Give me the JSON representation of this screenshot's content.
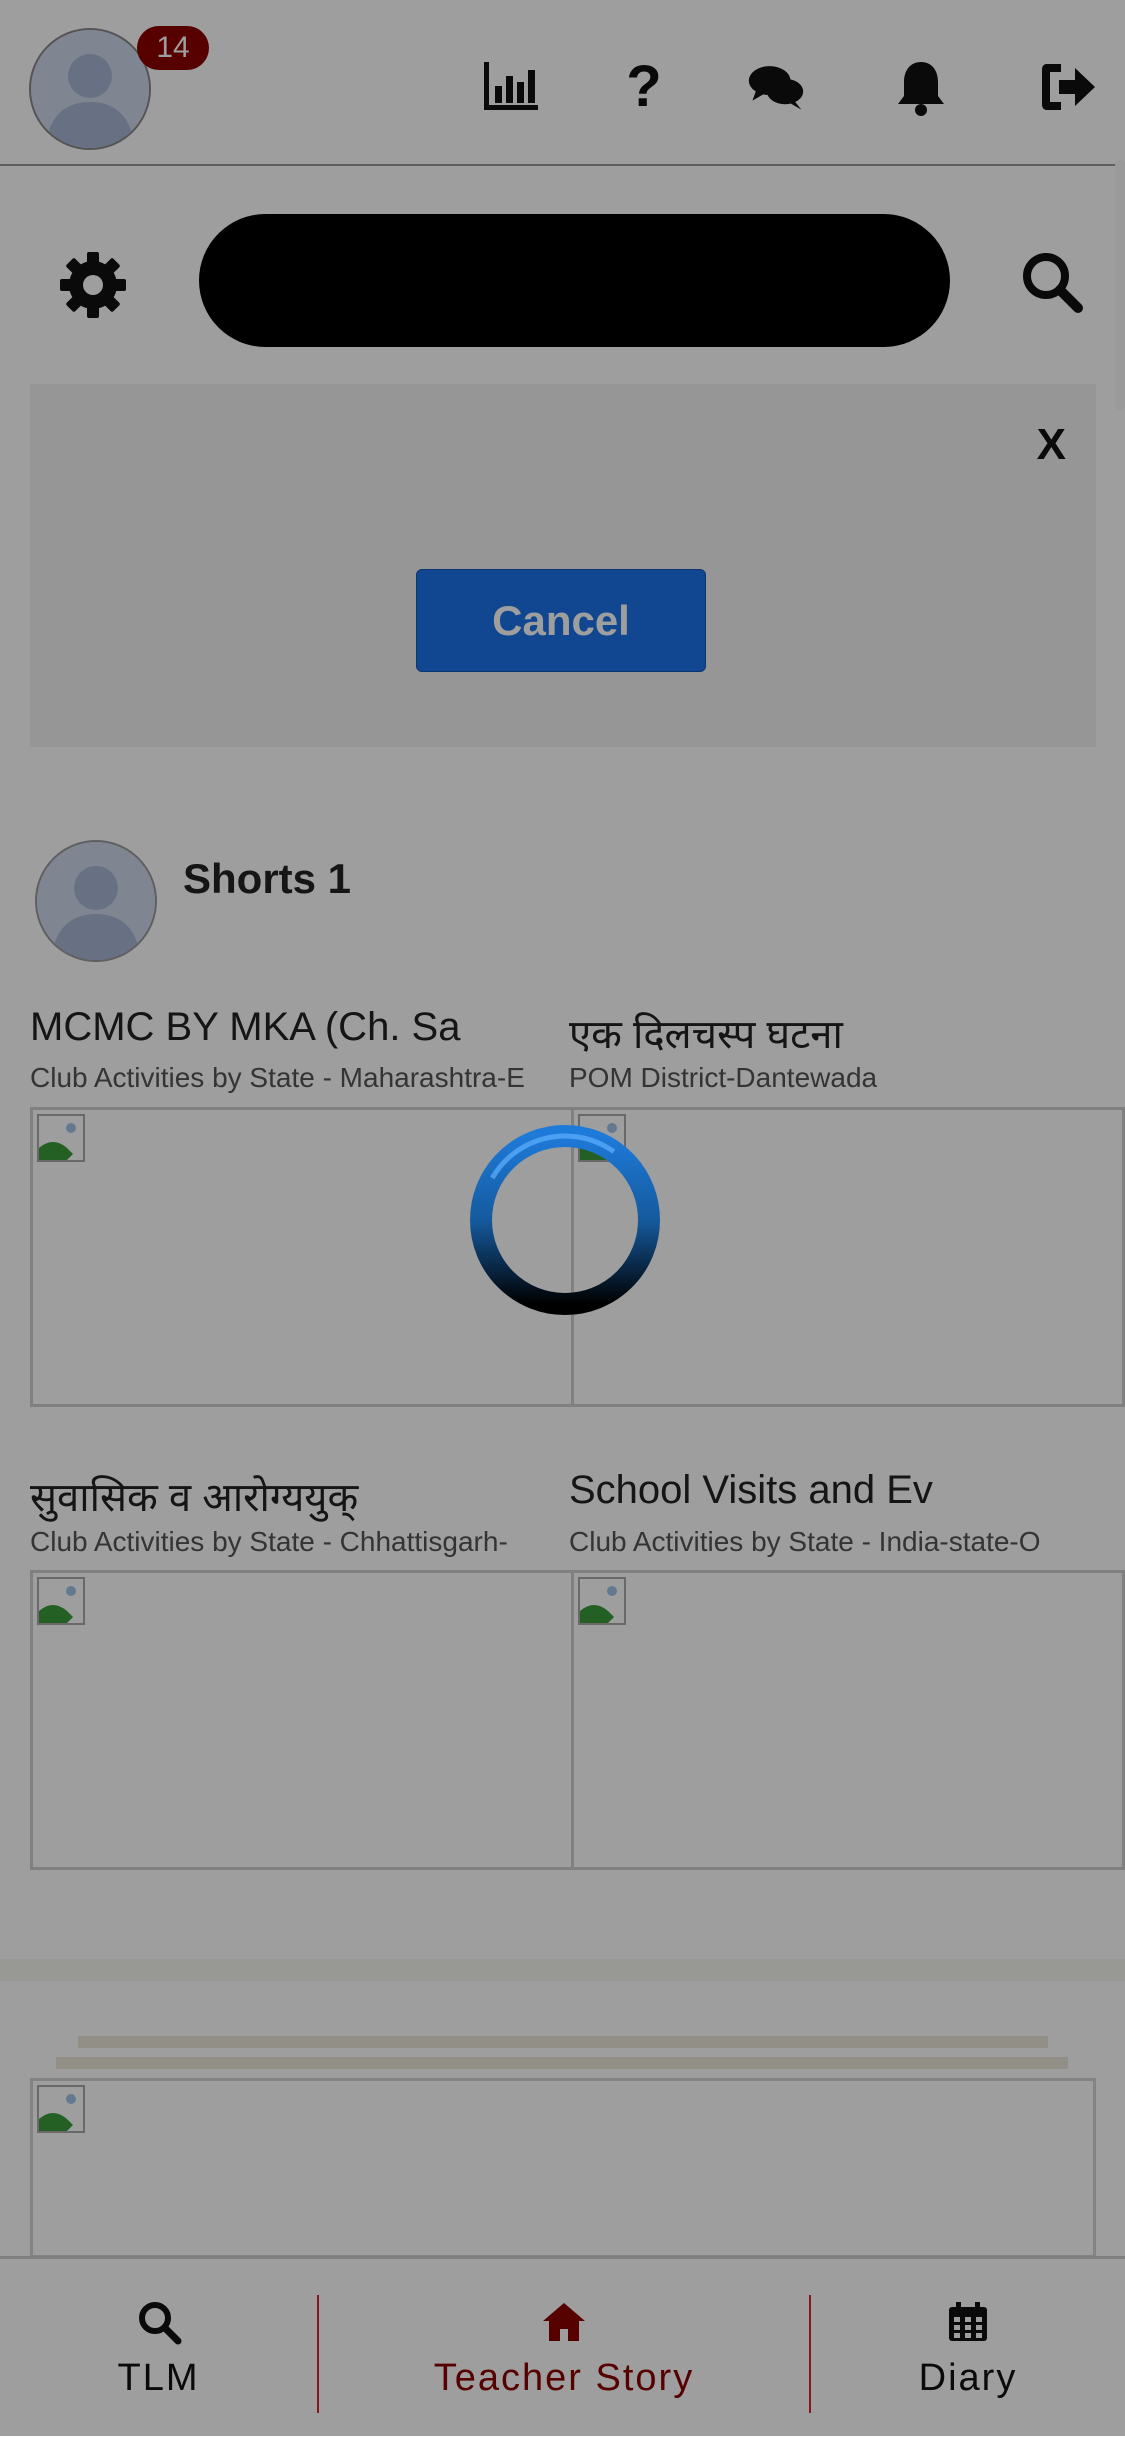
{
  "header": {
    "notification_count": "14",
    "icons": [
      "bar-chart-icon",
      "question-icon",
      "chat-icon",
      "bell-icon",
      "logout-icon"
    ],
    "help_glyph": "?"
  },
  "search": {
    "placeholder": ""
  },
  "dialog": {
    "close_label": "X",
    "cancel_label": "Cancel"
  },
  "shorts": {
    "title": "Shorts 1"
  },
  "cards": [
    {
      "title": "MCMC BY MKA (Ch. Sa",
      "subtitle": "Club Activities by State - Maharashtra-E"
    },
    {
      "title": "एक दिलचस्प घटना",
      "subtitle": "POM District-Dantewada"
    },
    {
      "title": "सुवासिक व आरोग्ययुक्",
      "subtitle": "Club Activities by State - Chhattisgarh-"
    },
    {
      "title": "School Visits and Ev",
      "subtitle": "Club Activities by State - India-state-O"
    }
  ],
  "bottom_nav": {
    "items": [
      {
        "label": "TLM",
        "icon": "search-icon"
      },
      {
        "label": "Teacher Story",
        "icon": "home-icon"
      },
      {
        "label": "Diary",
        "icon": "calendar-icon"
      }
    ]
  },
  "colors": {
    "badge": "#8b0000",
    "accent_red": "#8b0000",
    "cancel_blue": "#1a73e8",
    "divider_red": "#d4262b"
  }
}
